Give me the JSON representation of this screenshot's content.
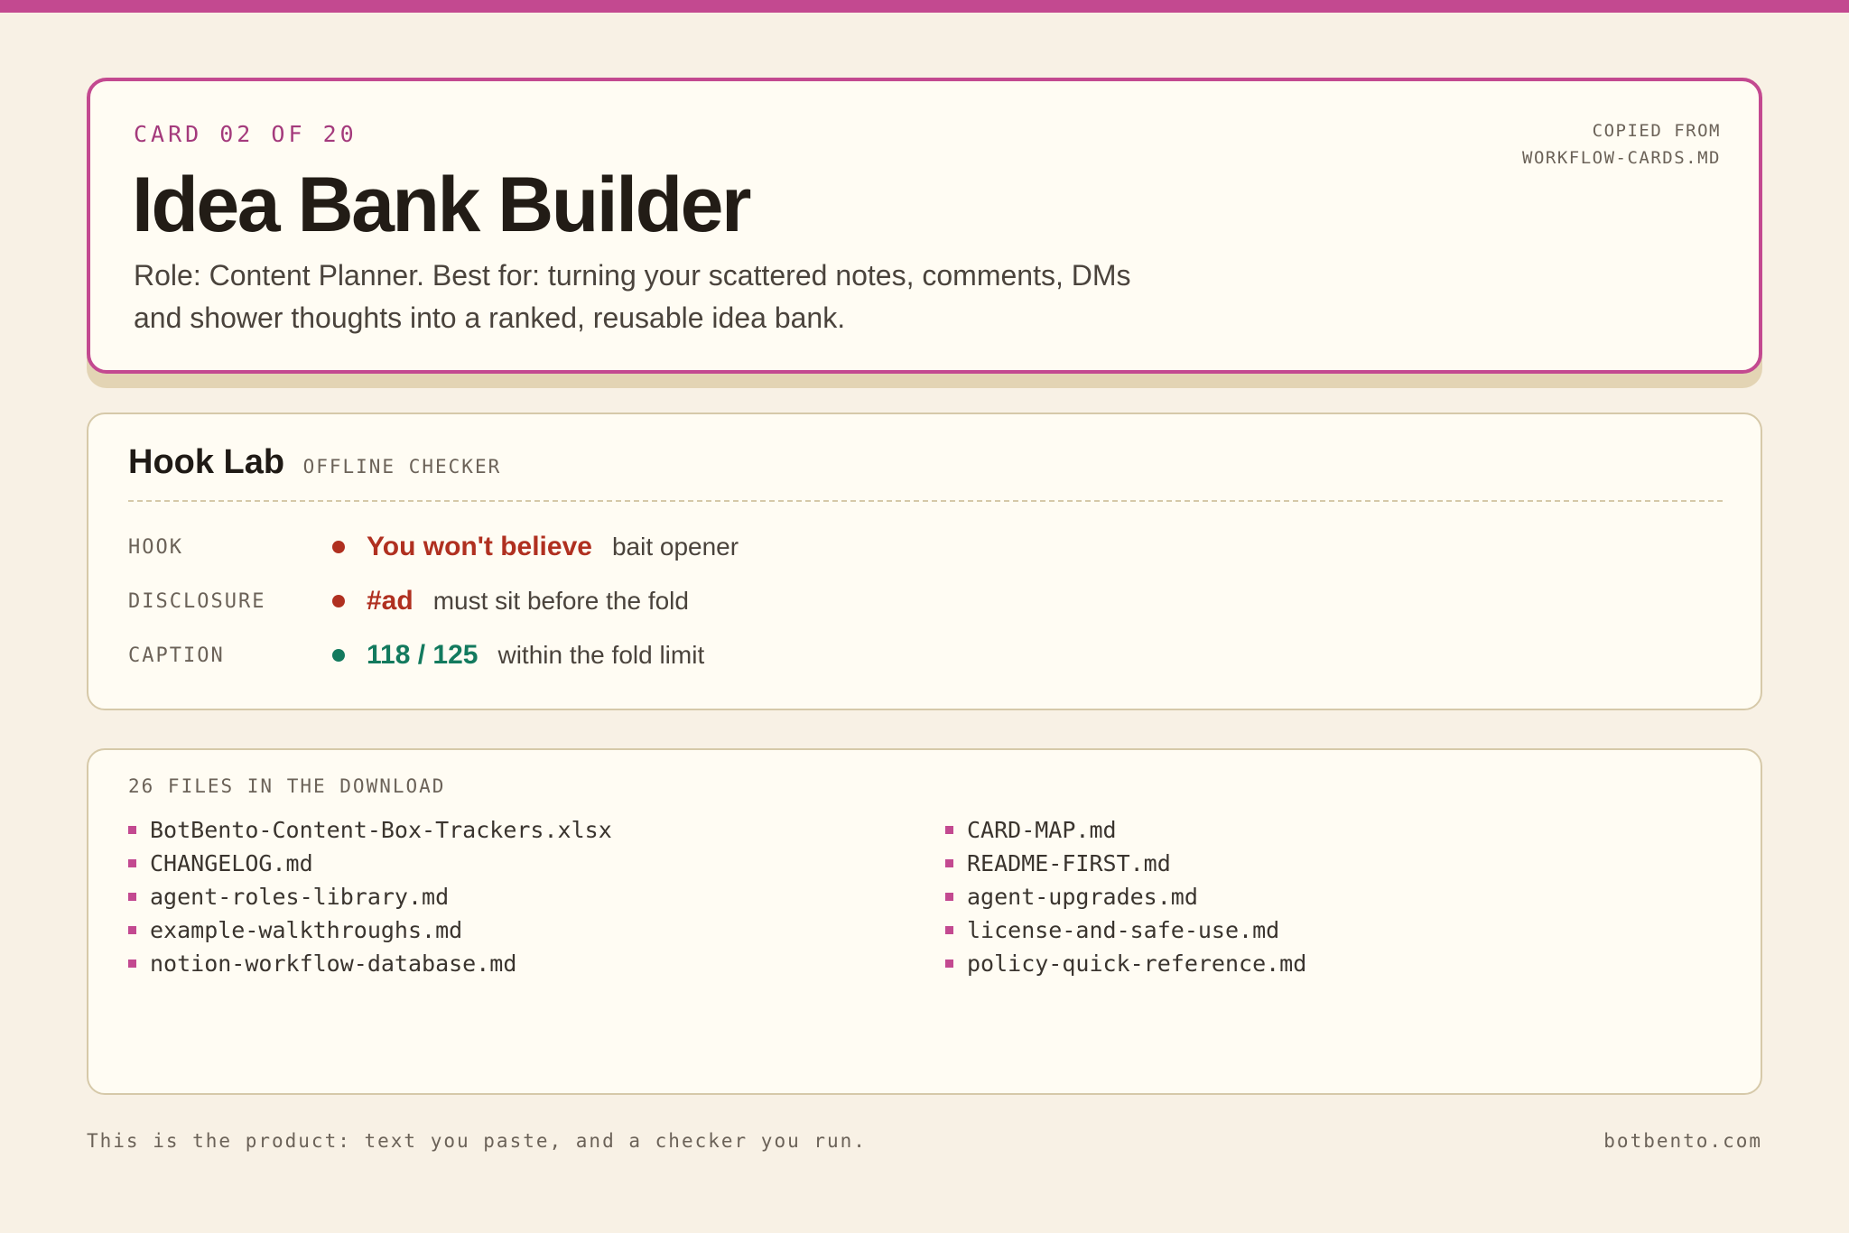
{
  "colors": {
    "accent": "#c34990",
    "background": "#f8f1e5",
    "card": "#fffcf3",
    "fail": "#b03020",
    "pass": "#137a5e"
  },
  "hero": {
    "eyebrow": "CARD 02 OF 20",
    "title": "Idea Bank Builder",
    "description": "Role: Content Planner. Best for: turning your scattered notes, comments, DMs and shower thoughts into a ranked, reusable idea bank.",
    "source_line1": "COPIED FROM",
    "source_line2": "WORKFLOW-CARDS.MD"
  },
  "hook_lab": {
    "title": "Hook Lab",
    "subtitle": "OFFLINE CHECKER",
    "checks": [
      {
        "label": "HOOK",
        "status": "fail",
        "value": "You won't believe",
        "note": "bait opener"
      },
      {
        "label": "DISCLOSURE",
        "status": "fail",
        "value": "#ad",
        "note": "must sit before the fold"
      },
      {
        "label": "CAPTION",
        "status": "pass",
        "value": "118 / 125",
        "note": "within the fold limit"
      }
    ]
  },
  "files": {
    "heading": "26 FILES IN THE DOWNLOAD",
    "left": [
      "BotBento-Content-Box-Trackers.xlsx",
      "CHANGELOG.md",
      "agent-roles-library.md",
      "example-walkthroughs.md",
      "notion-workflow-database.md"
    ],
    "right": [
      "CARD-MAP.md",
      "README-FIRST.md",
      "agent-upgrades.md",
      "license-and-safe-use.md",
      "policy-quick-reference.md"
    ]
  },
  "footer": {
    "left": "This is the product: text you paste, and a checker you run.",
    "right": "botbento.com"
  }
}
